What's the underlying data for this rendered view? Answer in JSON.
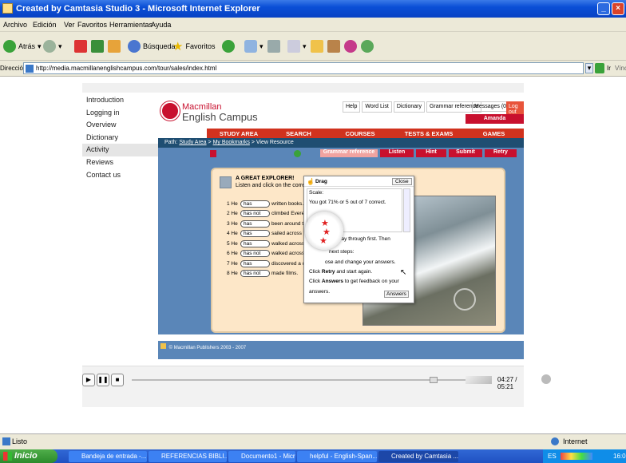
{
  "window": {
    "title": "Created by Camtasia Studio 3 - Microsoft Internet Explorer"
  },
  "menu": [
    "Archivo",
    "Edición",
    "Ver",
    "Favoritos",
    "Herramientas",
    "Ayuda"
  ],
  "toolbar": {
    "back": "Atrás",
    "search": "Búsqueda",
    "favorites": "Favoritos"
  },
  "address": {
    "label": "Dirección",
    "url": "http://media.macmillanenglishcampus.com/tour/sales/index.html",
    "go": "Ir",
    "links": "Vínculos"
  },
  "sidebar": {
    "items": [
      "Introduction",
      "Logging in",
      "Overview",
      "Dictionary",
      "Activity",
      "Reviews",
      "Contact us"
    ],
    "active_index": 4
  },
  "app": {
    "logo_line1": "Macmillan",
    "logo_line2": "English Campus",
    "top_links": [
      "Help",
      "Word List",
      "Dictionary",
      "Grammar reference",
      "Messages (0)"
    ],
    "logout": "Log out",
    "user": "Amanda",
    "nav": [
      "STUDY AREA",
      "SEARCH",
      "COURSES",
      "TESTS & EXAMS",
      "GAMES"
    ],
    "path_label": "Path:",
    "path_study": "Study Area",
    "path_sep1": ">",
    "path_bookmarks": "My Bookmarks",
    "path_rest": "> View Resource",
    "action_buttons": [
      "Grammar reference",
      "Listen",
      "Hint",
      "Submit",
      "Retry"
    ],
    "exercise_title": "A GREAT EXPLORER!",
    "exercise_instr": "Listen and click on the correct an",
    "rows": [
      {
        "num": "1 He",
        "choice": "has",
        "rest": "written books."
      },
      {
        "num": "2 He",
        "choice": "has not",
        "rest": "climbed Everest."
      },
      {
        "num": "3 He",
        "choice": "has",
        "rest": "been around the"
      },
      {
        "num": "4 He",
        "choice": "has",
        "rest": "sailed across the"
      },
      {
        "num": "5 He",
        "choice": "has",
        "rest": "walked across th"
      },
      {
        "num": "6 He",
        "choice": "has not",
        "rest": "walked across th"
      },
      {
        "num": "7 He",
        "choice": "has",
        "rest": "discovered a city."
      },
      {
        "num": "8 He",
        "choice": "has not",
        "rest": "made films."
      }
    ],
    "popup": {
      "drag": "Drag",
      "close": "Close",
      "scale": "Scale:",
      "score": "You got 71% or 5 out of 7 correct.",
      "line_a": "the way through first. Then",
      "line_b": "next steps:",
      "line_c": "ose and change your answers.",
      "line_d_pre": "Click ",
      "line_d_bold": "Retry",
      "line_d_post": " and start again.",
      "line_e_pre": "Click ",
      "line_e_bold": "Answers",
      "line_e_post": " to get feedback on your",
      "line_f": "answers.",
      "answers_btn": "Answers"
    },
    "footer": "© Macmillan Publishers 2003 - 2007"
  },
  "player": {
    "time": "04:27 / 05:21",
    "progress": 0.84
  },
  "status": {
    "left": "Listo",
    "zone": "Internet"
  },
  "taskbar": {
    "start": "Inicio",
    "tasks": [
      "Bandeja de entrada -...",
      "REFERENCIAS BIBLI...",
      "Documento1 - Micros...",
      "helpful - English-Span...",
      "Created by Camtasia ..."
    ],
    "lang": "ES",
    "clock": "16:0"
  },
  "colors": {
    "brand_red": "#c8102e",
    "nav_bar": "#d1321e",
    "path_bar": "#1f4e72",
    "panel_blue": "#5a86b8",
    "exercise_bg": "#fde7c8"
  }
}
